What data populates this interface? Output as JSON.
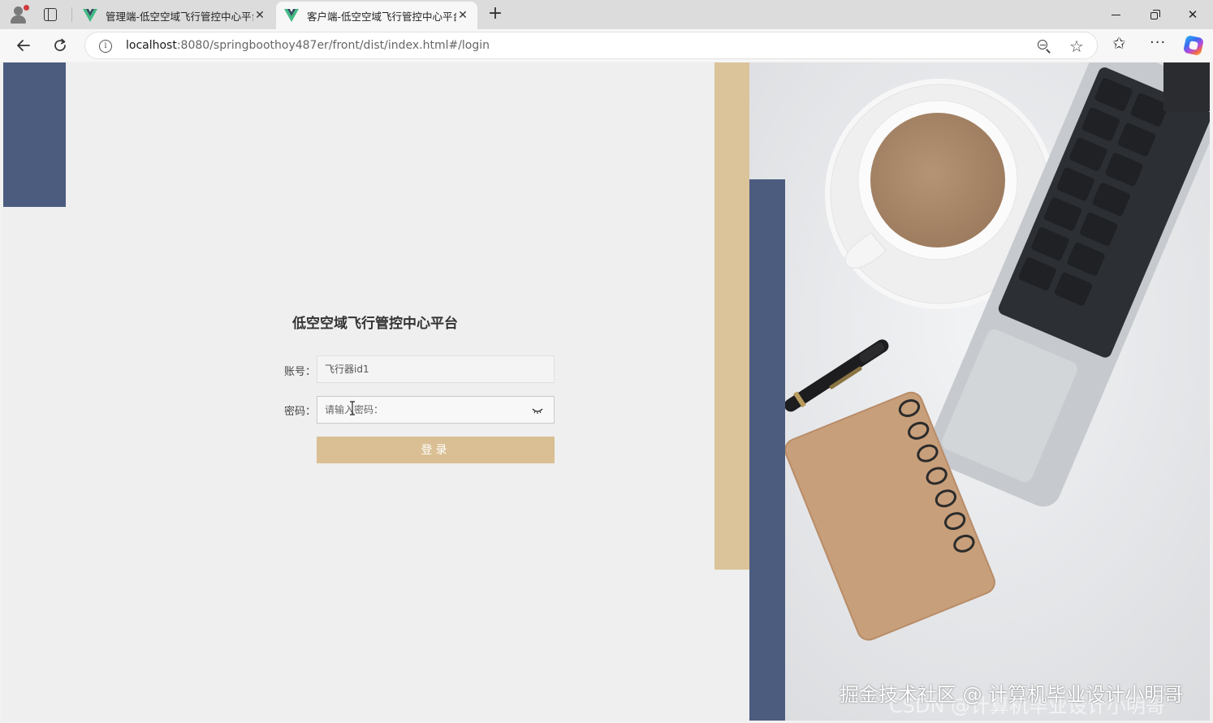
{
  "browser": {
    "tabs": [
      {
        "title": "管理端-低空空域飞行管控中心平台",
        "close": "✕"
      },
      {
        "title": "客户端-低空空域飞行管控中心平台",
        "close": "✕"
      }
    ],
    "new_tab": "+",
    "address": {
      "host": "localhost",
      "path": ":8080/springboothoy487er/front/dist/index.html#/login"
    },
    "window_controls": {
      "close": "✕"
    },
    "icons": {
      "back": "arrow-left-icon",
      "reload": "reload-icon",
      "info": "info-icon",
      "zoom": "zoom-out-icon",
      "star": "star-icon",
      "favorites": "favorites-icon",
      "more": "more-icon",
      "copilot": "copilot-icon"
    }
  },
  "login": {
    "title": "低空空域飞行管控中心平台",
    "username_label": "账号：",
    "username_value": "飞行器id1",
    "password_label": "密码：",
    "password_placeholder": "请输入密码：",
    "submit_label": "登录"
  },
  "colors": {
    "navy": "#4b5c7f",
    "tan": "#dbc39a",
    "button": "#d9bf93",
    "background": "#efefef"
  },
  "watermark": {
    "line1": "掘金技术社区 @ 计算机毕业设计小明哥",
    "line2": "CSDN @计算机毕业设计小明哥"
  }
}
